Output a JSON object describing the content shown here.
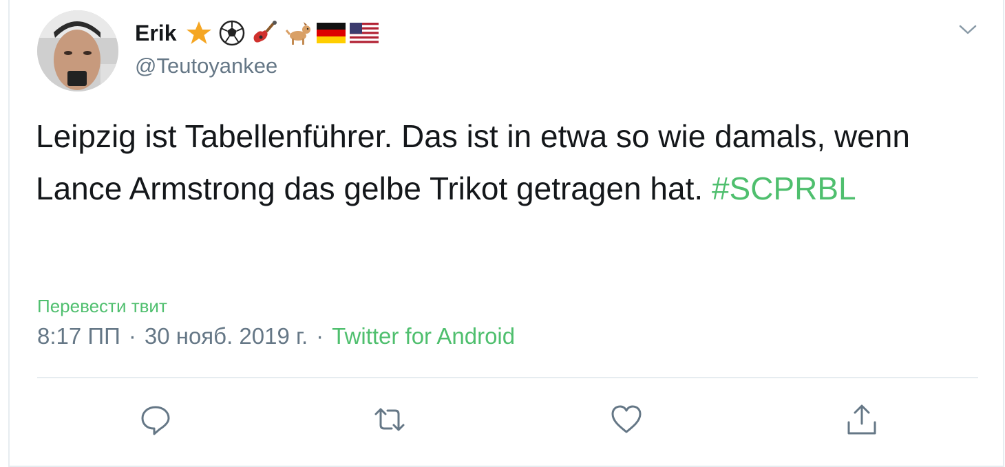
{
  "tweet": {
    "display_name": "Erik",
    "badges": [
      "star-emoji",
      "soccer-ball-emoji",
      "guitar-emoji",
      "dog-emoji",
      "germany-flag-emoji",
      "usa-flag-emoji"
    ],
    "handle": "@Teutoyankee",
    "text_before_hashtag": "Leipzig ist Tabellenführer. Das ist in etwa so wie damals, wenn Lance Armstrong das gelbe Trikot getragen hat.",
    "hashtag": "#SCPRBL",
    "translate_label": "Перевести твит",
    "time": "8:17 ПП",
    "date": "30 нояб. 2019 г.",
    "separator": "·",
    "source": "Twitter for Android"
  },
  "colors": {
    "accent": "#4fbf6e",
    "muted": "#657786",
    "text": "#14171a",
    "border": "#e6ecf0"
  },
  "actions": [
    "reply-icon",
    "retweet-icon",
    "like-icon",
    "share-icon"
  ]
}
